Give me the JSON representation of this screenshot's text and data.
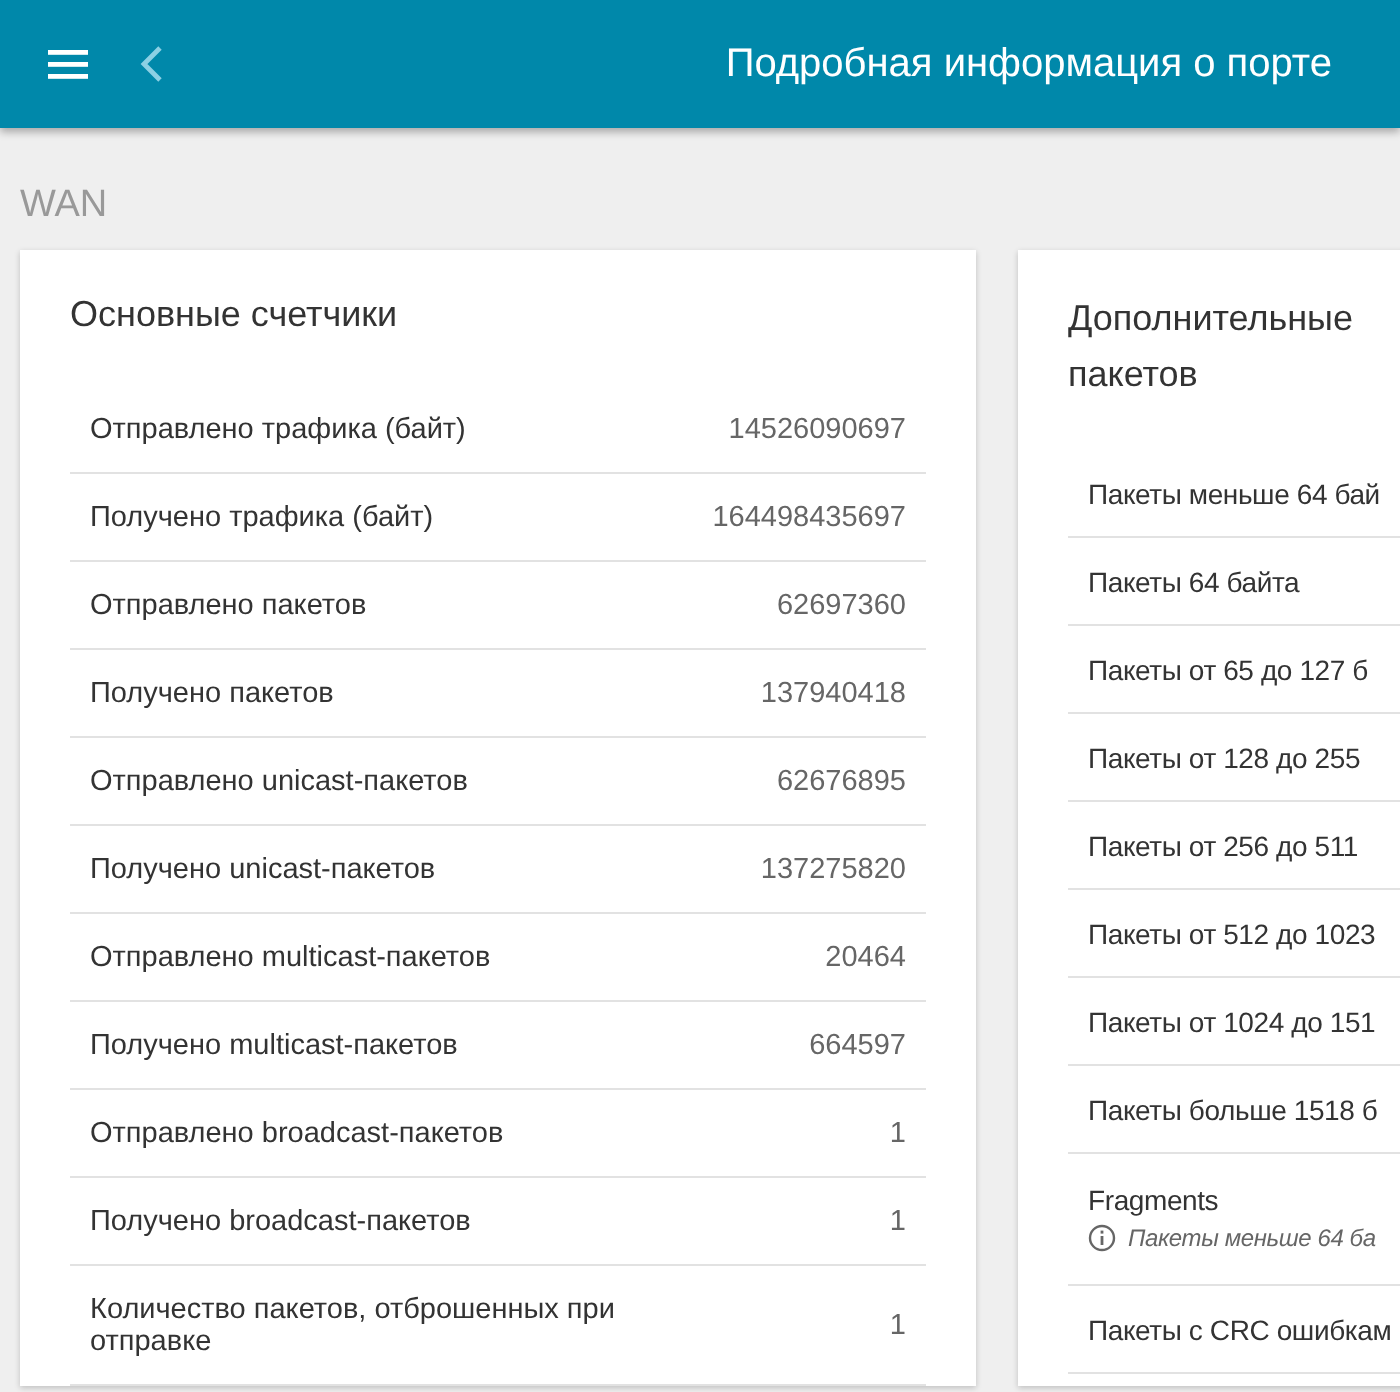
{
  "header": {
    "title": "Подробная информация о порте"
  },
  "section": "WAN",
  "main_counters": {
    "title": "Основные счетчики",
    "rows": [
      {
        "label": "Отправлено трафика (байт)",
        "value": "14526090697"
      },
      {
        "label": "Получено трафика (байт)",
        "value": "164498435697"
      },
      {
        "label": "Отправлено пакетов",
        "value": "62697360"
      },
      {
        "label": "Получено пакетов",
        "value": "137940418"
      },
      {
        "label": "Отправлено unicast-пакетов",
        "value": "62676895"
      },
      {
        "label": "Получено unicast-пакетов",
        "value": "137275820"
      },
      {
        "label": "Отправлено multicast-пакетов",
        "value": "20464"
      },
      {
        "label": "Получено multicast-пакетов",
        "value": "664597"
      },
      {
        "label": "Отправлено broadcast-пакетов",
        "value": "1"
      },
      {
        "label": "Получено broadcast-пакетов",
        "value": "1"
      },
      {
        "label": "Количество пакетов, отброшенных при отправке",
        "value": "1"
      }
    ]
  },
  "extra_counters": {
    "title_lines": [
      "Дополнительные",
      "пакетов"
    ],
    "rows": [
      {
        "label": "Пакеты меньше 64 бай"
      },
      {
        "label": "Пакеты 64 байта"
      },
      {
        "label": "Пакеты от 65 до 127 б"
      },
      {
        "label": "Пакеты от 128 до 255"
      },
      {
        "label": "Пакеты от 256 до 511"
      },
      {
        "label": "Пакеты от 512 до 1023"
      },
      {
        "label": "Пакеты от 1024 до 151"
      },
      {
        "label": "Пакеты больше 1518 б"
      },
      {
        "label": "Fragments",
        "hint": "Пакеты меньше 64 ба"
      },
      {
        "label": "Пакеты с CRC ошибкам"
      }
    ]
  }
}
